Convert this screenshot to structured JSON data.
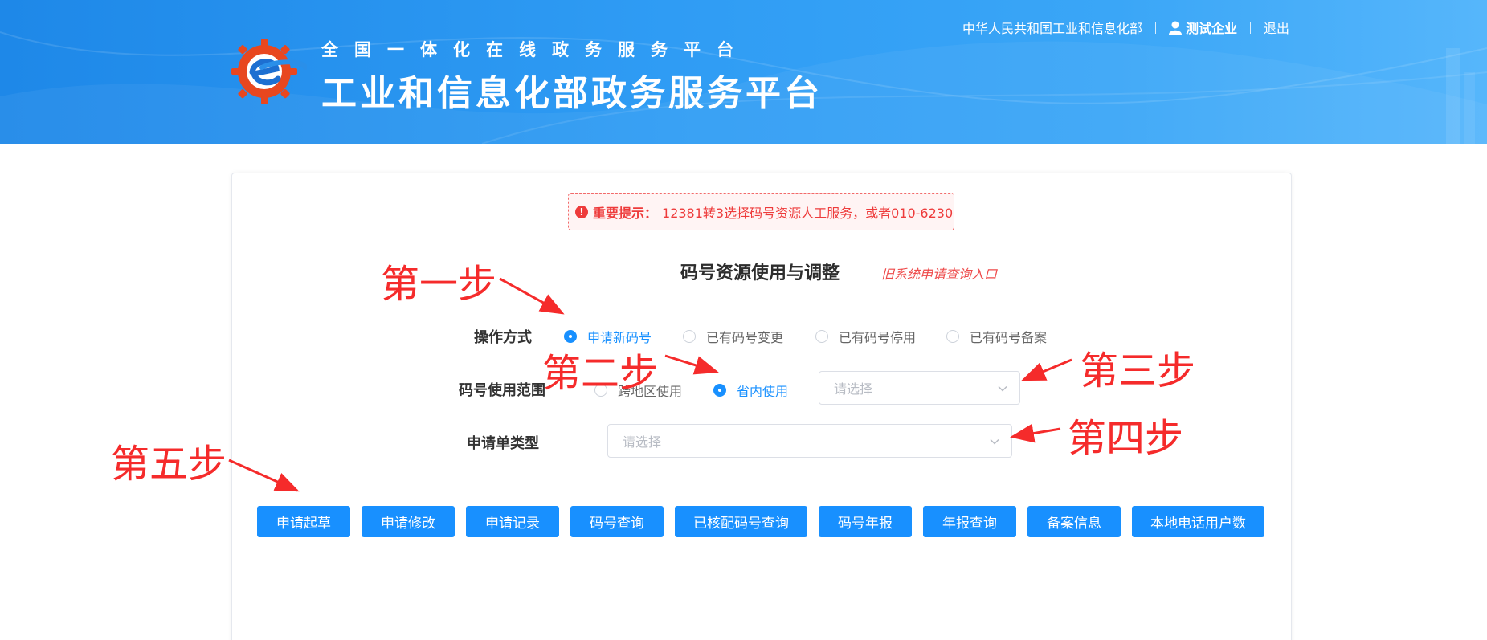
{
  "header": {
    "subtitle": "全国一体化在线政务服务平台",
    "title": "工业和信息化部政务服务平台",
    "nav": {
      "ministry": "中华人民共和国工业和信息化部",
      "user": "测试企业",
      "logout": "退出"
    }
  },
  "notice": {
    "label": "重要提示：",
    "text": "12381转3选择码号资源人工服务，或者010-6230"
  },
  "page": {
    "title": "码号资源使用与调整",
    "old_entry": "旧系统申请查询入口"
  },
  "form": {
    "operation": {
      "label": "操作方式",
      "options": [
        "申请新码号",
        "已有码号变更",
        "已有码号停用",
        "已有码号备案"
      ],
      "selected": "申请新码号"
    },
    "scope": {
      "label": "码号使用范围",
      "options": [
        "跨地区使用",
        "省内使用"
      ],
      "selected": "省内使用",
      "province_placeholder": "请选择"
    },
    "app_type": {
      "label": "申请单类型",
      "placeholder": "请选择"
    }
  },
  "buttons": [
    "申请起草",
    "申请修改",
    "申请记录",
    "码号查询",
    "已核配码号查询",
    "码号年报",
    "年报查询",
    "备案信息",
    "本地电话用户数"
  ],
  "annotations": {
    "step1": "第一步",
    "step2": "第二步",
    "step3": "第三步",
    "step4": "第四步",
    "step5": "第五步"
  },
  "colors": {
    "primary": "#1890ff",
    "annotation": "#f52b2b",
    "header": "#2f9cf4"
  }
}
